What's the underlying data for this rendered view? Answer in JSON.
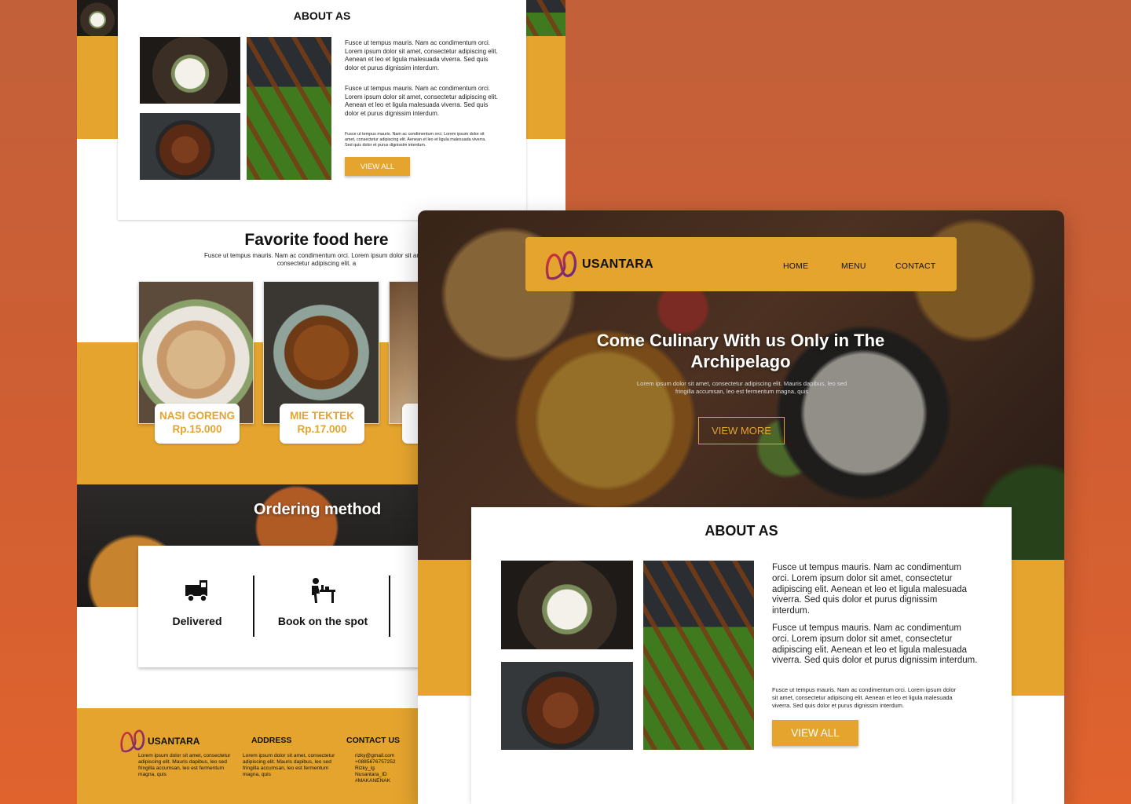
{
  "back_page": {
    "about": {
      "title": "ABOUT AS",
      "paragraphs": [
        "Fusce ut tempus mauris. Nam ac condimentum orci. Lorem ipsum dolor sit amet, consectetur adipiscing elit. Aenean et leo et ligula malesuada viverra. Sed quis dolor et purus dignissim interdum.",
        "Fusce ut tempus mauris. Nam ac condimentum orci. Lorem ipsum dolor sit amet, consectetur adipiscing elit. Aenean et leo et ligula malesuada viverra. Sed quis dolor et purus dignissim interdum.",
        "Fusce ut tempus mauris. Nam ac condimentum orci. Lorem ipsum dolor sit amet, consectetur adipiscing elit. Aenean et leo et ligula malesuada viverra. Sed quis dolor et purus dignissim interdum."
      ],
      "view_all": "VIEW ALL"
    },
    "favorite": {
      "title": "Favorite food here",
      "subtitle": "Fusce ut tempus mauris. Nam ac condimentum orci. Lorem ipsum dolor sit amet, consectetur adipiscing elit. a",
      "items": [
        {
          "name": "NASI GORENG",
          "price": "Rp.15.000"
        },
        {
          "name": "MIE TEKTEK",
          "price": "Rp.17.000"
        }
      ]
    },
    "ordering": {
      "title": "Ordering method",
      "methods": [
        {
          "label": "Delivered",
          "icon": "delivery-truck-icon"
        },
        {
          "label": "Book on the spot",
          "icon": "dine-in-table-icon"
        }
      ]
    },
    "footer": {
      "brand": "USANTARA",
      "brand_text": "Lorem ipsum dolor sit amet, consectetur adipiscing elit. Mauris dapibus, leo sed fringilla accumsan, leo est fermentum magna, quis",
      "address_title": "ADDRESS",
      "address_text": "Lorem ipsum dolor sit amet, consectetur adipiscing elit. Mauris dapibus, leo sed fringilla accumsan, leo est fermentum magna, quis",
      "contact_title": "CONTACT US",
      "contact_lines": [
        "rizky@gmail.com",
        "+0885676757252",
        "Rizky_lg",
        "Nusantara_ID",
        "#MAKANENAK"
      ]
    }
  },
  "front_page": {
    "nav": {
      "brand": "USANTARA",
      "links": [
        "HOME",
        "MENU",
        "CONTACT"
      ]
    },
    "hero": {
      "title": "Come Culinary With us Only in The Archipelago",
      "subtitle": "Lorem ipsum dolor sit amet, consectetur adipiscing elit. Mauris dapibus, leo sed fringilla accumsan, leo est fermentum magna, quis",
      "button": "VIEW MORE"
    },
    "about": {
      "title": "ABOUT AS",
      "paragraphs": [
        "Fusce ut tempus mauris. Nam ac condimentum orci. Lorem ipsum dolor sit amet, consectetur adipiscing elit. Aenean et leo et ligula malesuada viverra. Sed quis dolor et purus dignissim interdum.",
        "Fusce ut tempus mauris. Nam ac condimentum orci. Lorem ipsum dolor sit amet, consectetur adipiscing elit. Aenean et leo et ligula malesuada viverra. Sed quis dolor et purus dignissim interdum.",
        "Fusce ut tempus mauris. Nam ac condimentum orci. Lorem ipsum dolor sit amet, consectetur adipiscing elit. Aenean et leo et ligula malesuada viverra. Sed quis dolor et purus dignissim interdum."
      ],
      "view_all": "VIEW ALL"
    }
  },
  "colors": {
    "accent": "#e5a42e",
    "background_top": "#c2603a",
    "background_bottom": "#e0632e",
    "logo_gradient": [
      "#e0332e",
      "#5b2a86"
    ]
  }
}
